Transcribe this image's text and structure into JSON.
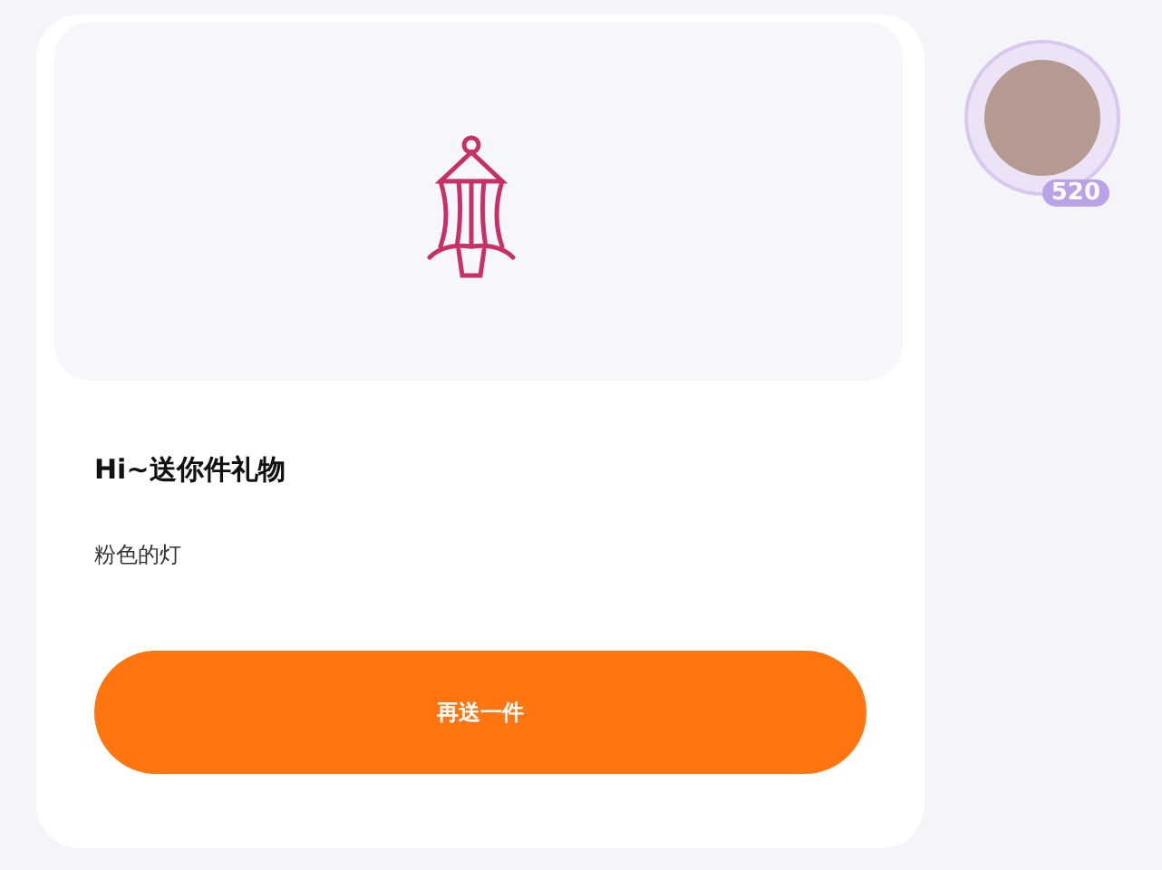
{
  "gift_card": {
    "title": "Hi~送你件礼物",
    "item_name": "粉色的灯",
    "button": "再送一件"
  },
  "avatar": {
    "badge": "520"
  }
}
